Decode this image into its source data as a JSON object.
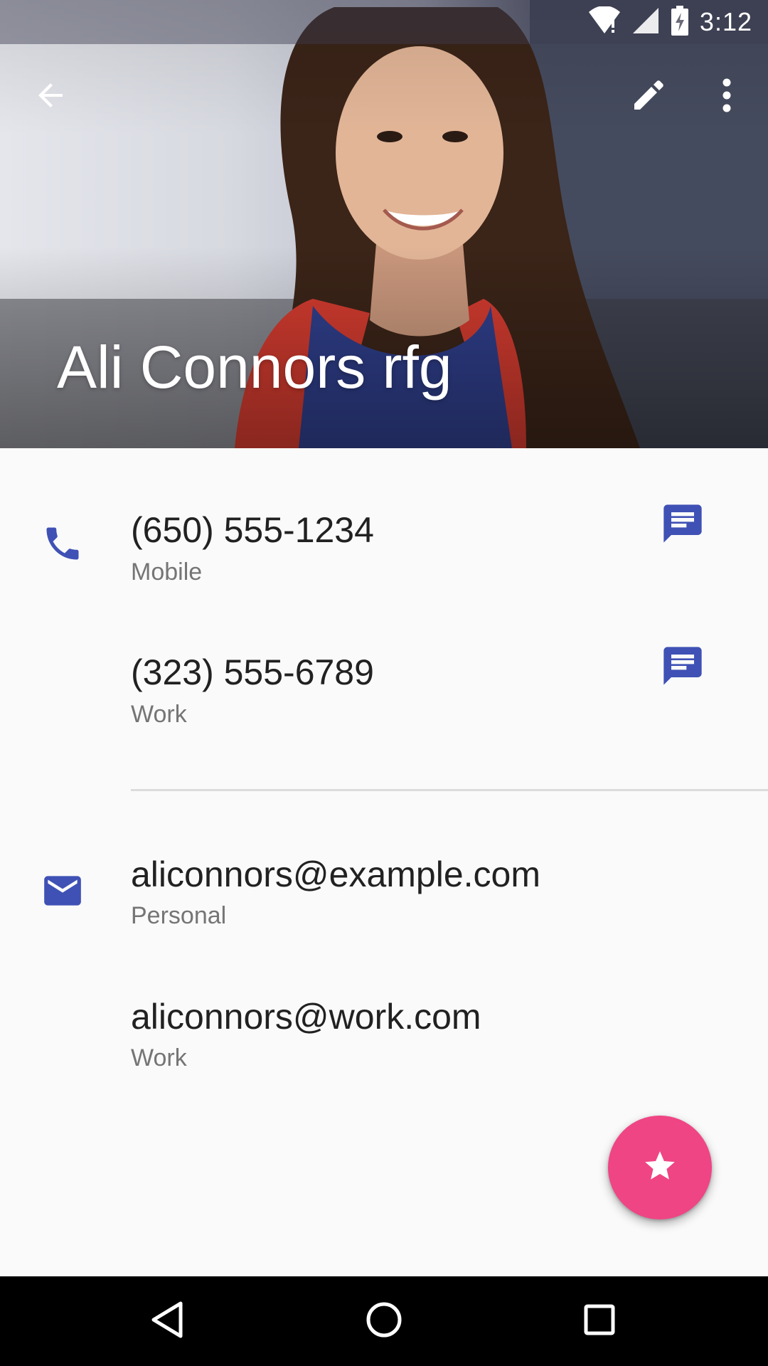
{
  "status_bar": {
    "time": "3:12",
    "icons": [
      "wifi-icon",
      "signal-icon",
      "battery-charging-icon"
    ]
  },
  "app_bar": {
    "back_icon": "arrow-back-icon",
    "edit_icon": "pencil-icon",
    "more_icon": "more-vert-icon"
  },
  "contact": {
    "name": "Ali Connors rfg"
  },
  "phones": [
    {
      "number": "(650) 555-1234",
      "type": "Mobile",
      "action_icon": "message-icon"
    },
    {
      "number": "(323) 555-6789",
      "type": "Work",
      "action_icon": "message-icon"
    }
  ],
  "emails": [
    {
      "address": "aliconnors@example.com",
      "type": "Personal"
    },
    {
      "address": "aliconnors@work.com",
      "type": "Work"
    }
  ],
  "fab": {
    "icon": "star-icon"
  },
  "nav_bar": {
    "icons": [
      "nav-back-icon",
      "nav-home-icon",
      "nav-recents-icon"
    ]
  },
  "colors": {
    "accent": "#3f51b5",
    "fab": "#ef4584",
    "primary_text": "#212121",
    "secondary_text": "#757575"
  }
}
